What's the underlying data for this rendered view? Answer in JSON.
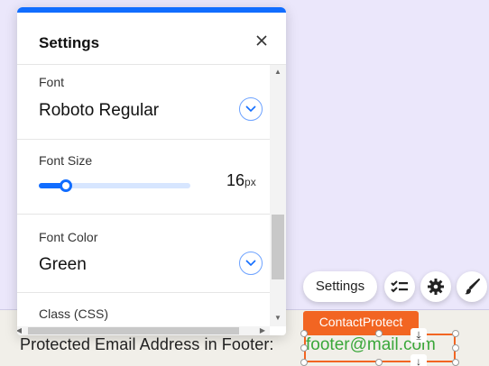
{
  "panel": {
    "title": "Settings",
    "sections": {
      "font": {
        "label": "Font",
        "value": "Roboto Regular"
      },
      "font_size": {
        "label": "Font Size",
        "value": "16",
        "unit": "px",
        "slider_fraction": 0.18
      },
      "font_color": {
        "label": "Font Color",
        "value": "Green"
      },
      "class_css": {
        "label": "Class (CSS)"
      }
    }
  },
  "action_bar": {
    "settings_label": "Settings",
    "icons": [
      "checklist-icon",
      "gear-icon",
      "paint-brush-icon"
    ]
  },
  "footer": {
    "label_text": "Protected Email Address in Footer:",
    "email_text": "footer@mail.com",
    "component_tag": "ContactProtect"
  },
  "colors": {
    "accent": "#116dff",
    "selection": "#f26522",
    "email_green": "#3aa73a",
    "canvas": "#ebe7fb"
  }
}
